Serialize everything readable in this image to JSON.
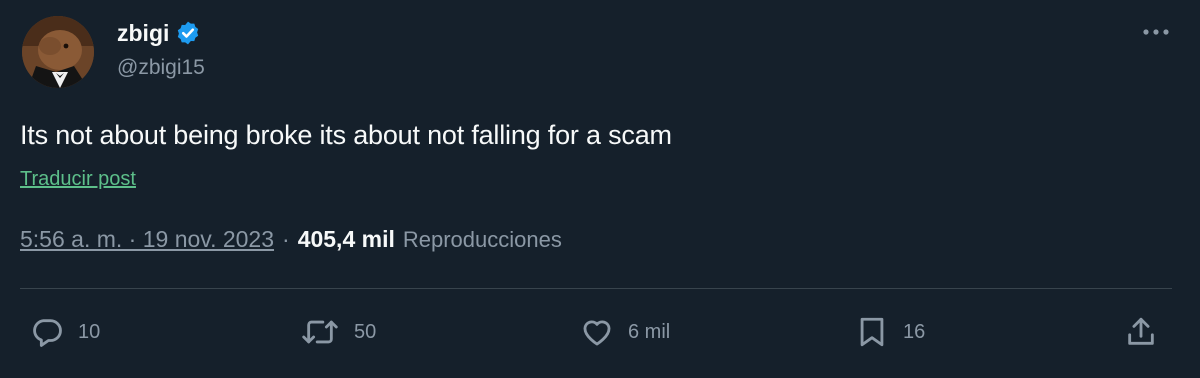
{
  "author": {
    "display_name": "zbigi",
    "handle": "@zbigi15",
    "verified": true
  },
  "tweet": {
    "text": "Its not about being broke its about not falling for a scam",
    "translate_label": "Traducir post",
    "timestamp": "5:56 a. m. · 19 nov. 2023",
    "separator": "·",
    "views_count": "405,4 mil",
    "views_label": "Reproducciones"
  },
  "actions": {
    "replies": "10",
    "reposts": "50",
    "likes": "6 mil",
    "bookmarks": "16"
  },
  "colors": {
    "background": "#15202b",
    "verified": "#1d9bf0",
    "link": "#5dbf8a",
    "secondary_text": "#8b98a5"
  },
  "icons": {
    "more": "more-icon",
    "verified": "verified-badge-icon",
    "reply": "reply-icon",
    "retweet": "retweet-icon",
    "like": "heart-icon",
    "bookmark": "bookmark-icon",
    "share": "share-icon"
  }
}
